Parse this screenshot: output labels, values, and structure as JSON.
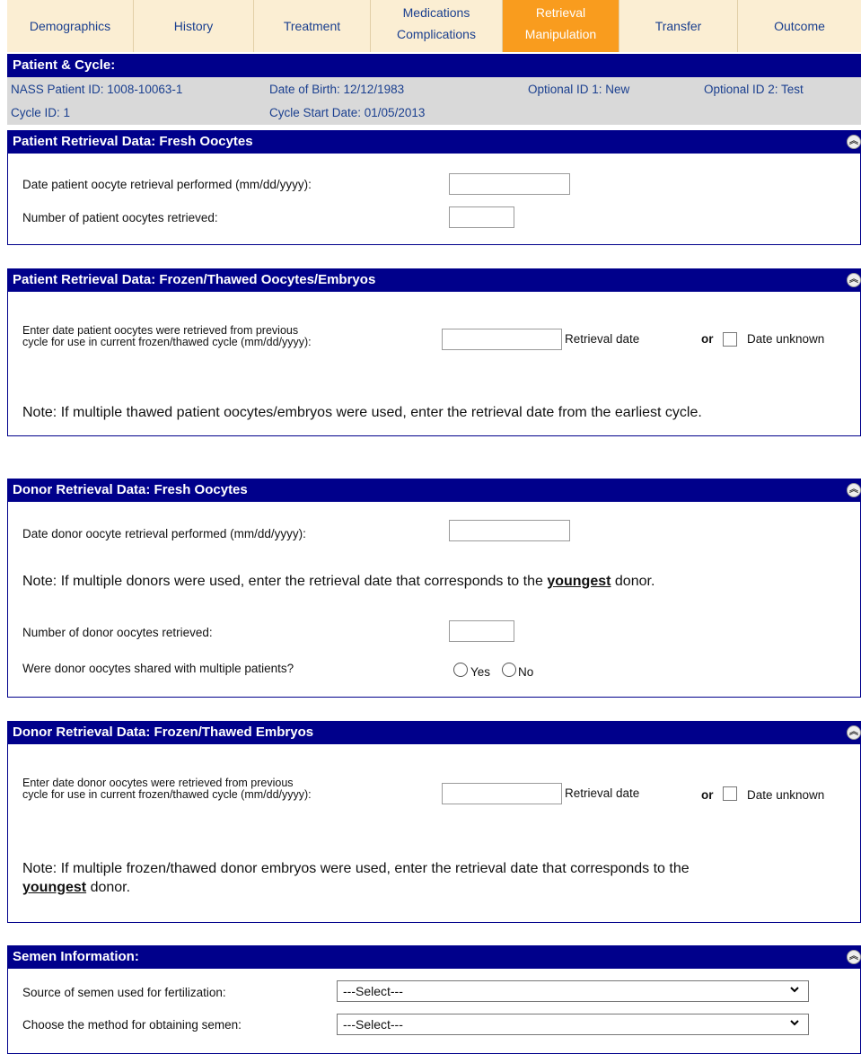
{
  "tabs": [
    {
      "label": "Demographics"
    },
    {
      "label": "History"
    },
    {
      "label": "Treatment"
    },
    {
      "line1": "Medications",
      "line2": "Complications"
    },
    {
      "line1": "Retrieval",
      "line2": "Manipulation",
      "active": true
    },
    {
      "label": "Transfer"
    },
    {
      "label": "Outcome"
    }
  ],
  "patient_cycle": {
    "title": "Patient & Cycle:",
    "nass_id": "NASS Patient ID:  1008-10063-1",
    "dob": "Date of Birth:  12/12/1983",
    "opt1": "Optional ID 1:  New",
    "opt2": "Optional ID 2:  Test",
    "cycle_id": "Cycle ID:  1",
    "cycle_start": "Cycle Start Date:  01/05/2013"
  },
  "fresh_patient": {
    "title": "Patient Retrieval Data:  Fresh Oocytes",
    "date_label": "Date patient oocyte retrieval performed (mm/dd/yyyy):",
    "date_value": "",
    "count_label": "Number of patient oocytes retrieved:",
    "count_value": ""
  },
  "frozen_patient": {
    "title": "Patient Retrieval Data:  Frozen/Thawed Oocytes/Embryos",
    "label_line1": "Enter date patient oocytes were retrieved from previous",
    "label_line2": "cycle for use in current frozen/thawed cycle (mm/dd/yyyy):",
    "retrieval_date_label": "Retrieval date",
    "or": "or",
    "unknown_label": "Date unknown",
    "note": "Note: If multiple thawed patient oocytes/embryos were used, enter the retrieval date from the earliest cycle."
  },
  "fresh_donor": {
    "title": "Donor Retrieval Data:  Fresh Oocytes",
    "date_label": "Date donor oocyte retrieval performed (mm/dd/yyyy):",
    "note_pre": "Note: If multiple donors were used, enter the retrieval date that corresponds to the ",
    "note_bold": "youngest",
    "note_post": " donor.",
    "count_label": "Number of donor oocytes retrieved:",
    "shared_label": "Were donor oocytes shared with multiple patients?",
    "yes": "Yes",
    "no": "No"
  },
  "frozen_donor": {
    "title": "Donor Retrieval Data:  Frozen/Thawed Embryos",
    "label_line1": "Enter date donor oocytes were retrieved from previous",
    "label_line2": "cycle for use in current frozen/thawed cycle (mm/dd/yyyy):",
    "retrieval_date_label": "Retrieval date",
    "or": "or",
    "unknown_label": "Date unknown",
    "note_pre": "Note: If multiple frozen/thawed donor embryos were used, enter the retrieval date that corresponds to the",
    "note_bold": "youngest",
    "note_post": " donor."
  },
  "semen": {
    "title": "Semen Information:",
    "source_label": "Source of semen used for fertilization:",
    "source_value": "---Select---",
    "method_label": "Choose the method for obtaining semen:",
    "method_value": "---Select---"
  },
  "icons": {
    "collapse": "collapse-up-icon",
    "dropdown": "chevron-down-icon"
  }
}
